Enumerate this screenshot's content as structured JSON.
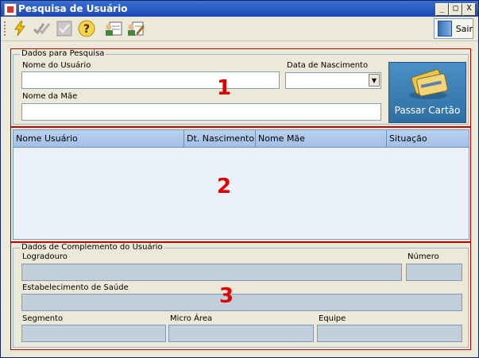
{
  "window": {
    "title": "Pesquisa de Usuário",
    "controls": {
      "minimize": "_",
      "maximize": "□",
      "close": "X"
    }
  },
  "toolbar": {
    "buttons": [
      {
        "icon": "lightning-icon"
      },
      {
        "icon": "double-check-icon"
      },
      {
        "icon": "check-icon"
      },
      {
        "icon": "help-icon"
      },
      {
        "icon": "user-card-icon"
      },
      {
        "icon": "edit-user-icon"
      }
    ],
    "exit_label": "Sair"
  },
  "search": {
    "legend": "Dados para Pesquisa",
    "name_label": "Nome do Usuário",
    "name_value": "",
    "birth_label": "Data de Nascimento",
    "birth_value": "",
    "mother_label": "Nome da Mãe",
    "mother_value": "",
    "card_button": "Passar Cartão",
    "marker": "1"
  },
  "results": {
    "columns": [
      "Nome Usuário",
      "Dt. Nascimento",
      "Nome Mãe",
      "Situação"
    ],
    "rows": [],
    "marker": "2"
  },
  "complement": {
    "legend": "Dados de Complemento do Usuário",
    "street_label": "Logradouro",
    "number_label": "Número",
    "health_label": "Estabelecimento de Saúde",
    "segment_label": "Segmento",
    "micro_label": "Micro Área",
    "team_label": "Equipe",
    "marker": "3"
  },
  "colors": {
    "marker": "#e00000",
    "outline": "#c00000",
    "titlebar": "#1f55c8",
    "disabled_field": "#c1cfdb"
  }
}
